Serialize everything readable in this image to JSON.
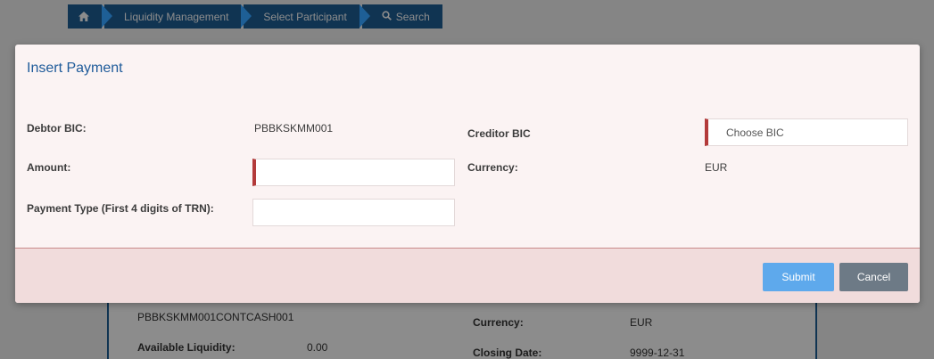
{
  "breadcrumb": {
    "items": [
      {
        "label": "",
        "icon": "home-icon"
      },
      {
        "label": "Liquidity Management"
      },
      {
        "label": "Select Participant"
      },
      {
        "label": "Search",
        "icon": "search-icon"
      }
    ]
  },
  "background": {
    "account": "PBBKSKMM001CONTCASH001",
    "available_liquidity_label": "Available Liquidity:",
    "available_liquidity_value": "0.00",
    "currency_label": "Currency:",
    "currency_value": "EUR",
    "closing_date_label": "Closing Date:",
    "closing_date_value": "9999-12-31"
  },
  "modal": {
    "title": "Insert Payment",
    "debtor_bic_label": "Debtor BIC:",
    "debtor_bic_value": "PBBKSKMM001",
    "creditor_bic_label": "Creditor BIC",
    "creditor_bic_placeholder": "Choose BIC",
    "amount_label": "Amount:",
    "amount_value": "",
    "currency_label": "Currency:",
    "currency_value": "EUR",
    "payment_type_label": "Payment Type (First 4 digits of TRN):",
    "payment_type_value": "",
    "submit_label": "Submit",
    "cancel_label": "Cancel"
  },
  "colors": {
    "primary": "#1e5f96",
    "submit": "#5ea9ec",
    "cancel": "#6d7a86",
    "required_marker": "#b33a3a"
  }
}
